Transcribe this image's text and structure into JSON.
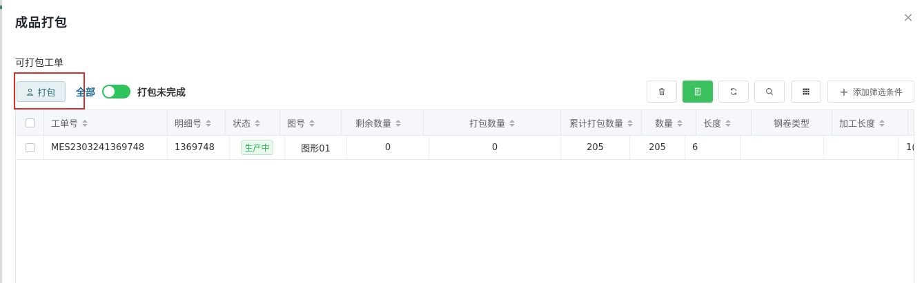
{
  "dialog": {
    "title": "成品打包",
    "close_icon": "×"
  },
  "section": {
    "title": "可打包工单"
  },
  "toolbar": {
    "pack_label": "打包",
    "all_label": "全部",
    "toggle_label": "打包未完成",
    "toggle_on": true,
    "filter_label": "添加筛选条件",
    "filter_plus": "+"
  },
  "table": {
    "columns": [
      "工单号",
      "明细号",
      "状态",
      "图号",
      "剩余数量",
      "打包数量",
      "累计打包数量",
      "数量",
      "长度",
      "钢卷类型",
      "加工长度"
    ],
    "rows": [
      {
        "work_order": "MES2303241369748",
        "detail_no": "1369748",
        "status": "生产中",
        "drawing_no": "图形01",
        "remaining_qty": "0",
        "pack_qty": "0",
        "cumulative_pack_qty": "205",
        "qty": "205",
        "length": "6",
        "coil_type": "",
        "process_length": "",
        "overflow": "1("
      }
    ]
  },
  "colors": {
    "accent_green": "#3bc15e",
    "highlight_red": "#d9302b",
    "pack_btn_text": "#2f6f7d"
  }
}
